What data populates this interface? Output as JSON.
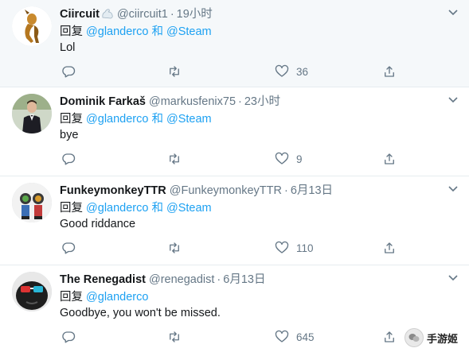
{
  "tweets": [
    {
      "name": "Ciircuit",
      "handle": "@ciircuit1",
      "time": "19小时",
      "reply_prefix": "回复",
      "mention1": "@glanderco",
      "conj": "和",
      "mention2": "@Steam",
      "text": "Lol",
      "likes": "36"
    },
    {
      "name": "Dominik Farkaš",
      "handle": "@markusfenix75",
      "time": "23小时",
      "reply_prefix": "回复",
      "mention1": "@glanderco",
      "conj": "和",
      "mention2": "@Steam",
      "text": "bye",
      "likes": "9"
    },
    {
      "name": "FunkeymonkeyTTR",
      "handle": "@FunkeymonkeyTTR",
      "time": "6月13日",
      "reply_prefix": "回复",
      "mention1": "@glanderco",
      "conj": "和",
      "mention2": "@Steam",
      "text": "Good riddance",
      "likes": "110"
    },
    {
      "name": "The Renegadist",
      "handle": "@renegadist",
      "time": "6月13日",
      "reply_prefix": "回复",
      "mention1": "@glanderco",
      "text": "Goodbye, you won't be missed.",
      "likes": "645"
    }
  ],
  "watermark": "手游姬",
  "colors": {
    "link": "#1da1f2",
    "meta": "#657786",
    "divider": "#e6ecf0",
    "first_row_bg": "#f5f8fa"
  }
}
